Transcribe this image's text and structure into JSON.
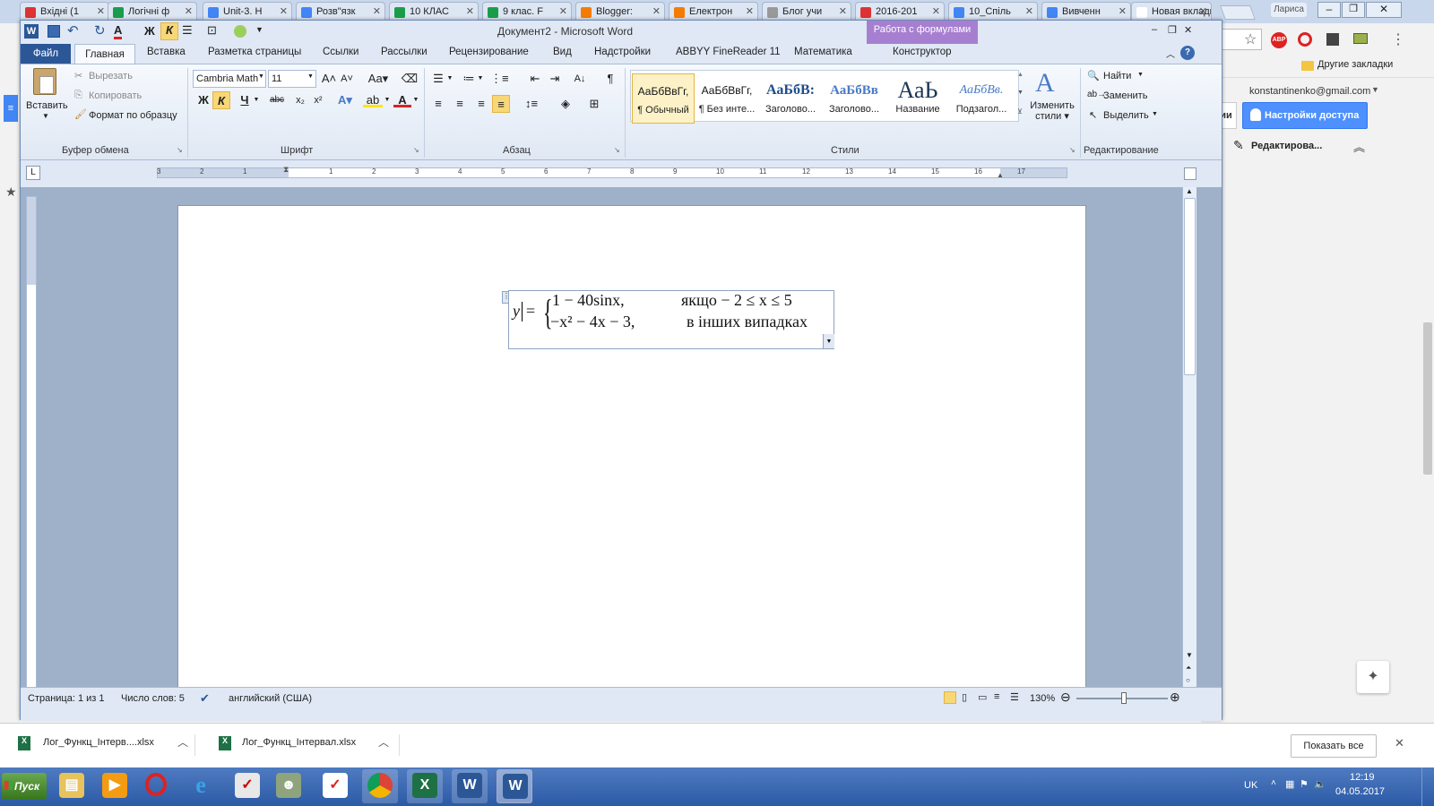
{
  "browser": {
    "tabs": [
      {
        "label": "Вхідні (1",
        "color": "#d33"
      },
      {
        "label": "Логічні ф",
        "color": "#1a9d4a"
      },
      {
        "label": "Unit-3. H",
        "color": "#4285f4"
      },
      {
        "label": "Розв\"язк",
        "color": "#4285f4"
      },
      {
        "label": "10 КЛАС",
        "color": "#1a9d4a"
      },
      {
        "label": "9 клас. F",
        "color": "#1a9d4a"
      },
      {
        "label": "Blogger:",
        "color": "#f57c00"
      },
      {
        "label": "Електрон",
        "color": "#f57c00"
      },
      {
        "label": "Блог учи",
        "color": "#999"
      },
      {
        "label": "2016-201",
        "color": "#d33"
      },
      {
        "label": "10_Спіль",
        "color": "#4285f4"
      },
      {
        "label": "Вивченн",
        "color": "#4285f4"
      },
      {
        "label": "Новая вкладк",
        "color": "#fff"
      }
    ],
    "user_chip": "Лариса",
    "bookmarks_other": "Другие закладки",
    "account_email": "konstantinenko@gmail.com",
    "share_partial": "тарии",
    "share_button": "Настройки доступа",
    "edit_mode": "Редактирова..."
  },
  "word": {
    "title": "Документ2 - Microsoft Word",
    "context_tab_group": "Работа с формулами",
    "tabs": {
      "file": "Файл",
      "home": "Главная",
      "insert": "Вставка",
      "layout": "Разметка страницы",
      "refs": "Ссылки",
      "mailings": "Рассылки",
      "review": "Рецензирование",
      "view": "Вид",
      "addins": "Надстройки",
      "abbyy": "ABBYY FineReader 11",
      "math": "Математика",
      "design": "Конструктор"
    },
    "clipboard": {
      "paste": "Вставить",
      "cut": "Вырезать",
      "copy": "Копировать",
      "format_painter": "Формат по образцу",
      "label": "Буфер обмена"
    },
    "font": {
      "name": "Cambria Math",
      "size": "11",
      "label": "Шрифт"
    },
    "paragraph": {
      "label": "Абзац"
    },
    "styles": {
      "label": "Стили",
      "change": "Изменить стили",
      "items": [
        {
          "preview": "АаБбВвГг,",
          "name": "¶ Обычный"
        },
        {
          "preview": "АаБбВвГг,",
          "name": "¶ Без инте..."
        },
        {
          "preview": "АаБбВ:",
          "name": "Заголово..."
        },
        {
          "preview": "АаБбВв",
          "name": "Заголово..."
        },
        {
          "preview": "АаЬ",
          "name": "Название"
        },
        {
          "preview": "АаБбВв.",
          "name": "Подзагол..."
        }
      ]
    },
    "editing": {
      "find": "Найти",
      "replace": "Заменить",
      "select": "Выделить",
      "label": "Редактирование"
    },
    "ruler_numbers": [
      "3",
      "2",
      "1",
      "1",
      "2",
      "3",
      "4",
      "5",
      "6",
      "7",
      "8",
      "9",
      "10",
      "11",
      "12",
      "13",
      "14",
      "15",
      "16",
      "17"
    ],
    "equation": {
      "lhs": "y",
      "eq": "=",
      "row1_expr": "1 − 40sinx,",
      "row1_cond": "якщо  − 2 ≤ x ≤ 5",
      "row2_expr": "−x² − 4x − 3,",
      "row2_cond": "в інших випадках"
    },
    "status": {
      "page": "Страница: 1 из 1",
      "words": "Число слов: 5",
      "lang": "английский (США)",
      "zoom": "130%"
    }
  },
  "downloads": {
    "items": [
      "Лог_Функц_Інтерв....xlsx",
      "Лог_Функц_Інтервал.xlsx"
    ],
    "show_all": "Показать все"
  },
  "taskbar": {
    "start": "Пуск",
    "lang": "UK",
    "time": "12:19",
    "date": "04.05.2017"
  }
}
